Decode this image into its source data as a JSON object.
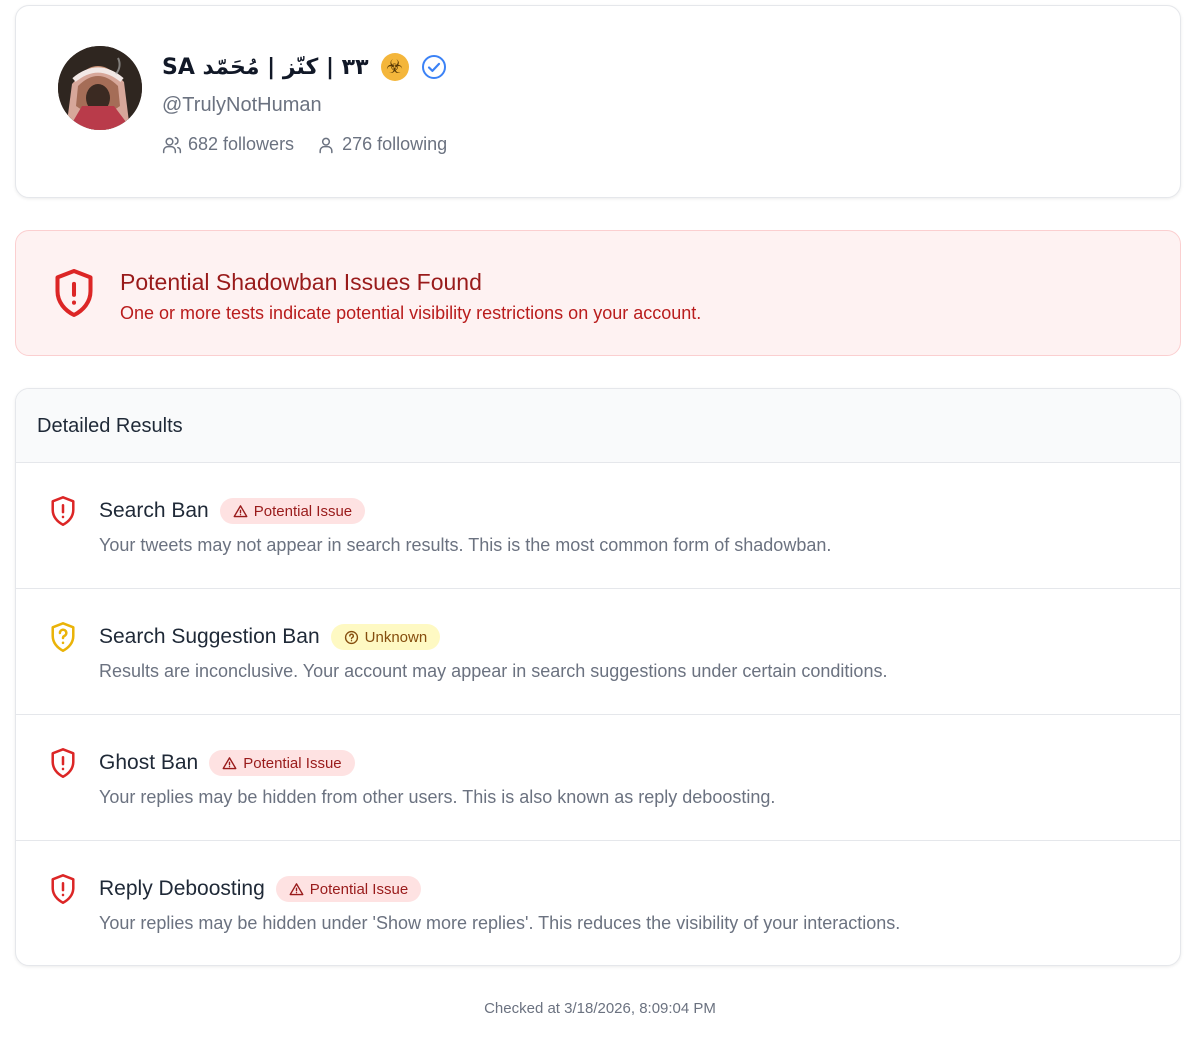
{
  "profile": {
    "display_name": "SA ٣٣ | كنّز | مُحَمّد",
    "emoji": "☣",
    "handle": "@TrulyNotHuman",
    "followers": "682 followers",
    "following": "276 following"
  },
  "alert": {
    "title": "Potential Shadowban Issues Found",
    "text": "One or more tests indicate potential visibility restrictions on your account."
  },
  "results": {
    "heading": "Detailed Results",
    "items": [
      {
        "title": "Search Ban",
        "status": "Potential Issue",
        "description": "Your tweets may not appear in search results. This is the most common form of shadowban."
      },
      {
        "title": "Search Suggestion Ban",
        "status": "Unknown",
        "description": "Results are inconclusive. Your account may appear in search suggestions under certain conditions."
      },
      {
        "title": "Ghost Ban",
        "status": "Potential Issue",
        "description": "Your replies may be hidden from other users. This is also known as reply deboosting."
      },
      {
        "title": "Reply Deboosting",
        "status": "Potential Issue",
        "description": "Your replies may be hidden under 'Show more replies'. This reduces the visibility of your interactions."
      }
    ]
  },
  "footer": {
    "checked_at": "Checked at 3/18/2026, 8:09:04 PM"
  },
  "colors": {
    "issue": "#dc2626",
    "unknown": "#eab308",
    "verified": "#3b82f6",
    "alert_bg": "#fef2f2"
  }
}
